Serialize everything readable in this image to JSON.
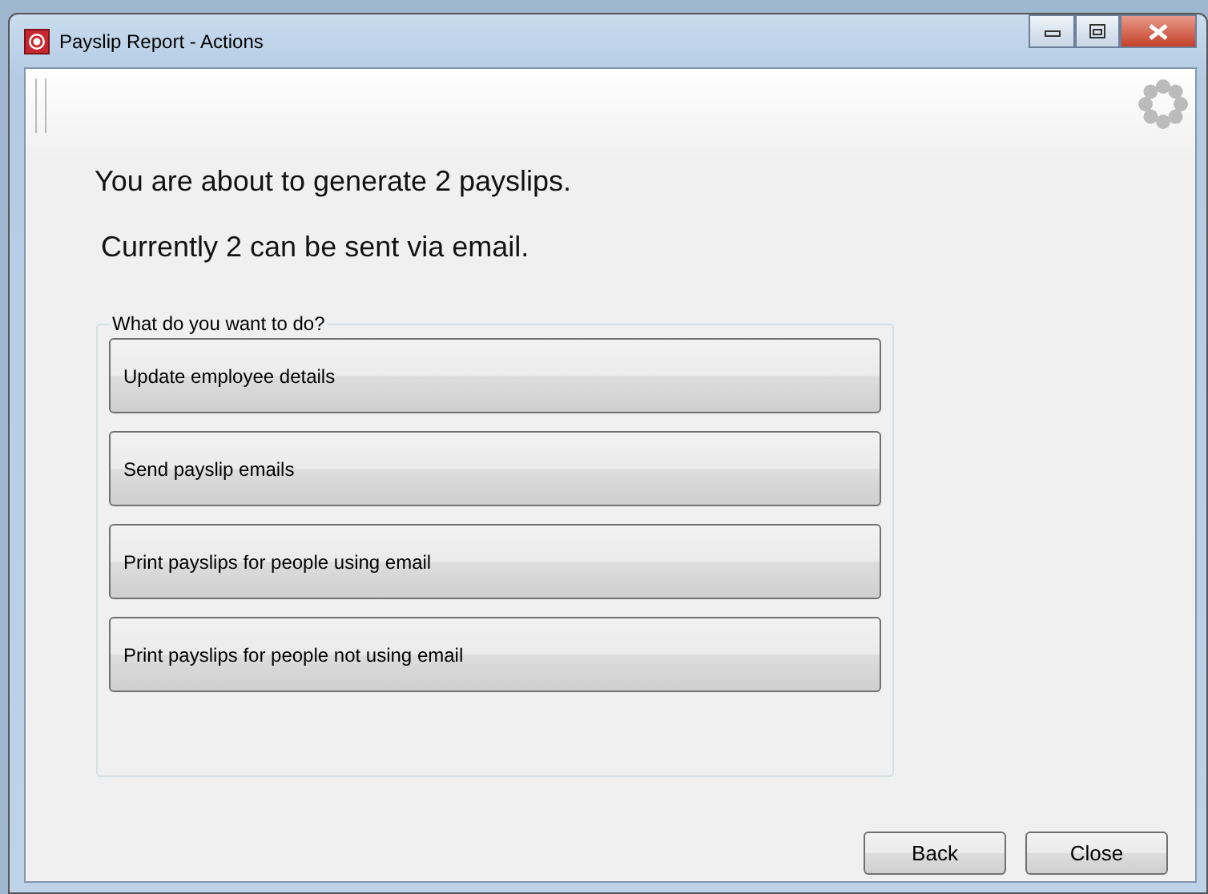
{
  "window": {
    "title": "Payslip Report - Actions"
  },
  "messages": [
    "You are about to generate 2 payslips.",
    "Currently 2 can be sent via email."
  ],
  "group": {
    "label": "What do you want to do?",
    "actions": [
      "Update employee details",
      "Send payslip emails",
      "Print payslips for people using email",
      "Print payslips for people not using email"
    ]
  },
  "buttons": [
    "Back",
    "Close"
  ]
}
